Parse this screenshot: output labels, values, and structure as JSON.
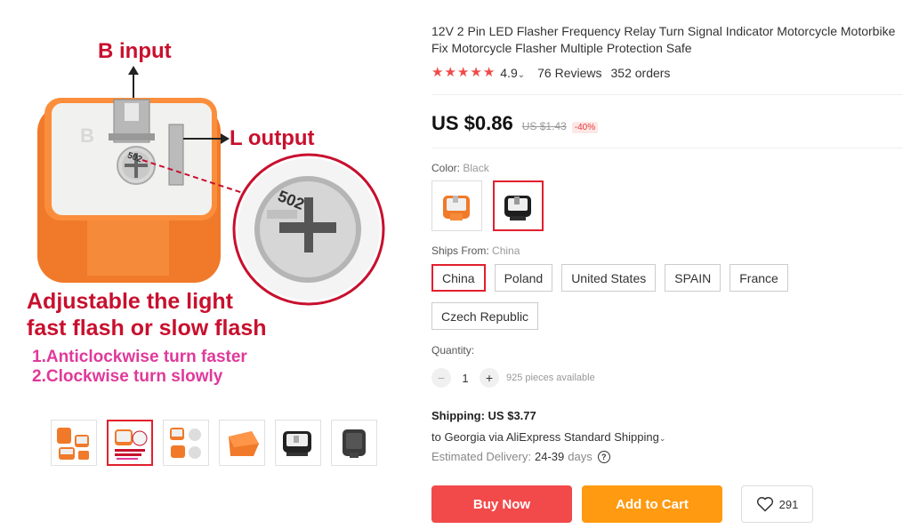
{
  "image": {
    "label_b_input": "B input",
    "label_l_output": "L output",
    "headline_line1": "Adjustable the light",
    "headline_line2": "fast flash or slow flash",
    "step1": "1.Anticlockwise turn faster",
    "step2": "2.Clockwise turn slowly",
    "pot_text": "502",
    "thumbnails": [
      {
        "icon": "orange-flasher-set"
      },
      {
        "icon": "annotated-flasher",
        "active": true
      },
      {
        "icon": "flasher-views"
      },
      {
        "icon": "orange-flasher"
      },
      {
        "icon": "black-flasher"
      },
      {
        "icon": "black-flasher-back"
      }
    ]
  },
  "product": {
    "title": "12V 2 Pin LED Flasher Frequency Relay Turn Signal Indicator Motorcycle Motorbike Fix Motorcycle Flasher Multiple Protection Safe",
    "rating": "4.9",
    "reviews": "76 Reviews",
    "orders": "352 orders",
    "price": "US $0.86",
    "old_price": "US $1.43",
    "discount": "-40%"
  },
  "color": {
    "label": "Color:",
    "value": "Black",
    "options": [
      "orange",
      "black"
    ],
    "selected": "black"
  },
  "ships_from": {
    "label": "Ships From:",
    "value": "China",
    "options": [
      "China",
      "Poland",
      "United States",
      "SPAIN",
      "France",
      "Czech Republic"
    ]
  },
  "quantity": {
    "label": "Quantity:",
    "value": "1",
    "minus": "−",
    "plus": "+",
    "available": "925 pieces available"
  },
  "shipping": {
    "title": "Shipping: US $3.77",
    "to": "to Georgia via AliExpress Standard Shipping",
    "delivery_label": "Estimated Delivery:",
    "delivery_days": "24-39",
    "delivery_unit": "days",
    "help_icon": "?"
  },
  "actions": {
    "buy_now": "Buy Now",
    "add_to_cart": "Add to Cart",
    "wishlist_count": "291"
  },
  "colors": {
    "accent": "#e21f2e",
    "buy": "#f24a4a",
    "cart": "#ff9a11",
    "star": "#f04a4a",
    "device_orange": "#f07a2a"
  }
}
